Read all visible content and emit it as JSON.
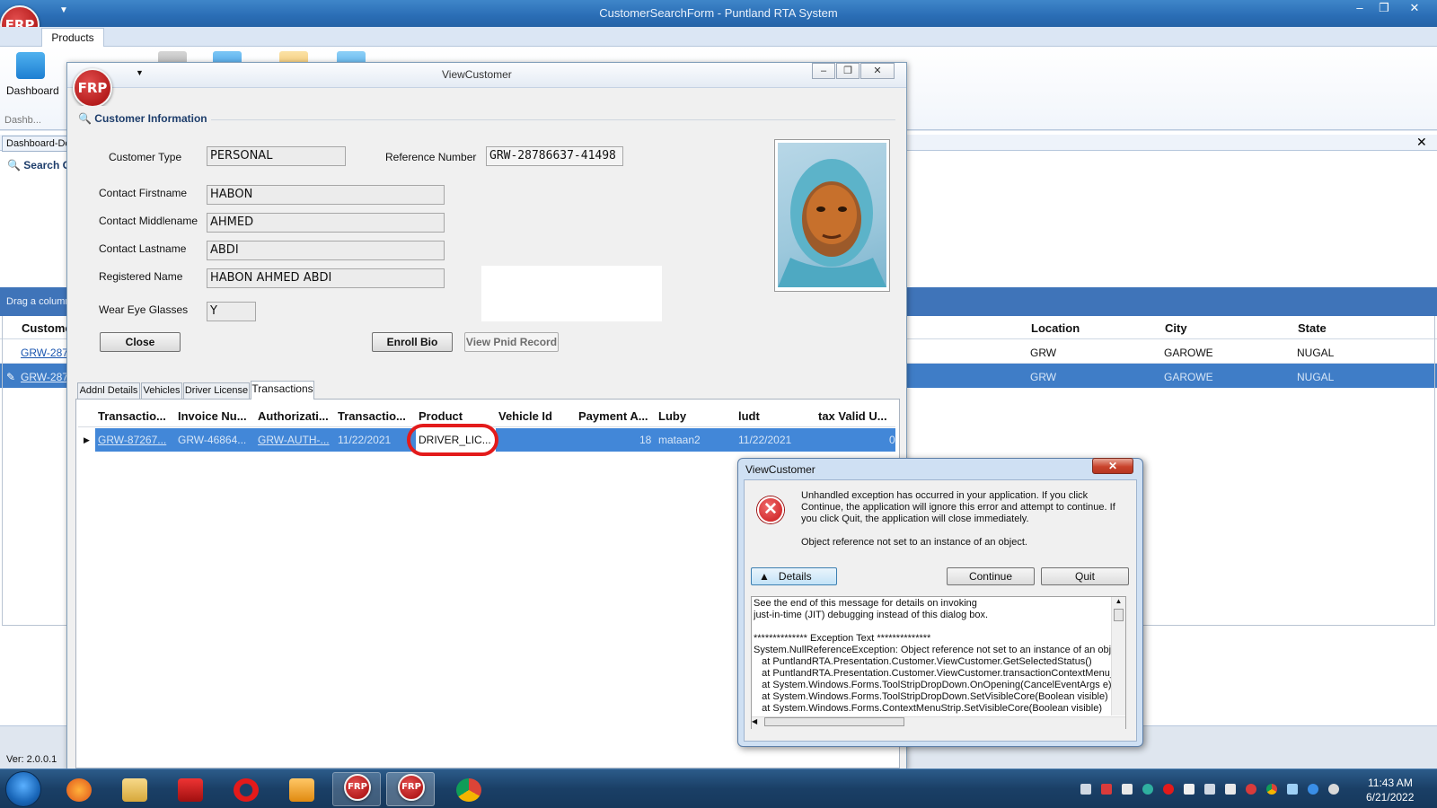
{
  "main_window": {
    "title": "CustomerSearchForm - Puntland RTA System",
    "controls": [
      "–",
      "❐",
      "✕"
    ]
  },
  "app_logo_text": "FRP",
  "ribbon": {
    "tab": "Products",
    "dashboard_label": "Dashboard",
    "group_label": "Dashb..."
  },
  "search_form": {
    "tab_label": "Dashboard-De",
    "search_label": "Search C",
    "group_hint": "Drag a column",
    "columns": [
      "Custome",
      "Location",
      "City",
      "State"
    ],
    "rows": [
      {
        "id": "GRW-287",
        "location": "GRW",
        "city": "GAROWE",
        "state": "NUGAL"
      },
      {
        "id": "GRW-287",
        "location": "GRW",
        "city": "GAROWE",
        "state": "NUGAL"
      }
    ],
    "version": "Ver: 2.0.0.1"
  },
  "view_customer": {
    "title": "ViewCustomer",
    "section_title": "Customer Information",
    "customer_type_label": "Customer Type",
    "customer_type": "PERSONAL",
    "reference_label": "Reference Number",
    "reference_number": "GRW-28786637-41498",
    "firstname_label": "Contact Firstname",
    "firstname": "HABON",
    "middlename_label": "Contact Middlename",
    "middlename": "AHMED",
    "lastname_label": "Contact Lastname",
    "lastname": "ABDI",
    "registered_label": "Registered Name",
    "registered_name": "HABON AHMED ABDI",
    "glasses_label": "Wear Eye Glasses",
    "glasses": "Y",
    "close_btn": "Close",
    "enroll_btn": "Enroll Bio",
    "pnid_btn": "View Pnid Record",
    "tabs": [
      "Addnl Details",
      "Vehicles",
      "Driver License",
      "Transactions"
    ],
    "trans_columns": [
      "Transactio...",
      "Invoice Nu...",
      "Authorizati...",
      "Transactio...",
      "Product",
      "Vehicle Id",
      "Payment A...",
      "Luby",
      "ludt",
      "tax Valid U..."
    ],
    "trans_row": {
      "transaction": "GRW-87267...",
      "invoice": "GRW-46864...",
      "authorization": "GRW-AUTH-...",
      "date": "11/22/2021",
      "product": "DRIVER_LIC...",
      "vehicle_id": "",
      "payment": "18",
      "luby": "mataan2",
      "ludt": "11/22/2021",
      "tax_valid": "0"
    }
  },
  "error_dialog": {
    "title": "ViewCustomer",
    "message": "Unhandled exception has occurred in your application. If you click Continue, the application will ignore this error and attempt to continue. If you click Quit, the application will close immediately.",
    "object_message": "Object reference not set to an instance of an object.",
    "details_btn": "Details",
    "continue_btn": "Continue",
    "quit_btn": "Quit",
    "details_text": "See the end of this message for details on invoking\njust-in-time (JIT) debugging instead of this dialog box.\n\n************** Exception Text **************\nSystem.NullReferenceException: Object reference not set to an instance of an object.\n   at PuntlandRTA.Presentation.Customer.ViewCustomer.GetSelectedStatus()\n   at PuntlandRTA.Presentation.Customer.ViewCustomer.transactionContextMenu_Opening\n   at System.Windows.Forms.ToolStripDropDown.OnOpening(CancelEventArgs e)\n   at System.Windows.Forms.ToolStripDropDown.SetVisibleCore(Boolean visible)\n   at System.Windows.Forms.ContextMenuStrip.SetVisibleCore(Boolean visible)"
  },
  "taskbar": {
    "time": "11:43 AM",
    "date": "6/21/2022"
  },
  "colors": {
    "accent": "#3f7dc7",
    "highlight_ring": "#e31b1b",
    "selected_row": "#4287d8"
  }
}
